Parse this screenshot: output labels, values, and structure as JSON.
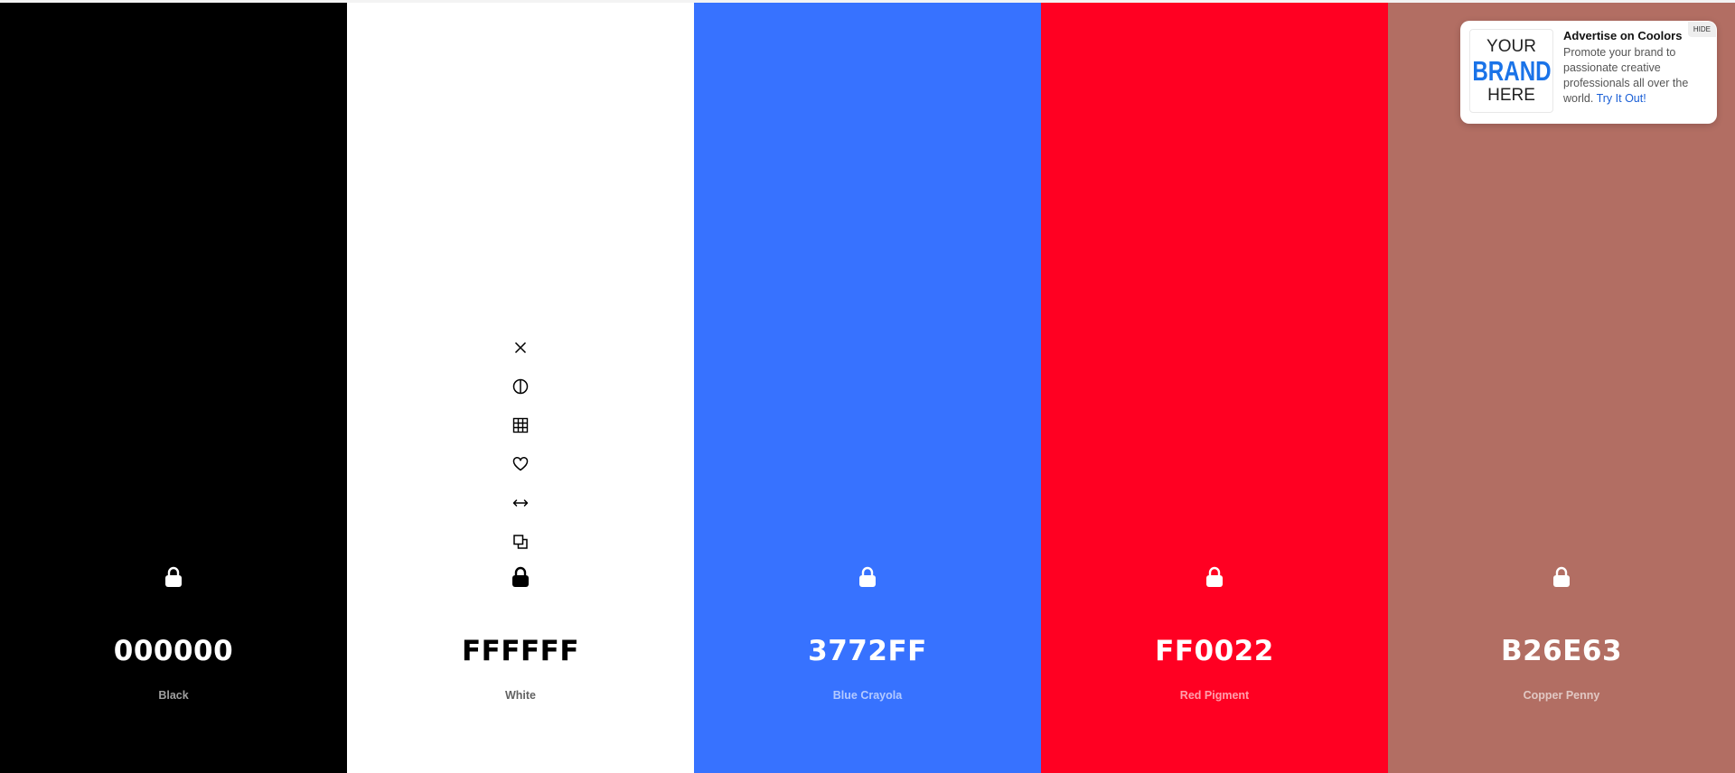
{
  "swatches": [
    {
      "hex": "000000",
      "name": "Black",
      "bg": "#000000",
      "tone": "dark"
    },
    {
      "hex": "FFFFFF",
      "name": "White",
      "bg": "#FFFFFF",
      "tone": "light"
    },
    {
      "hex": "3772FF",
      "name": "Blue Crayola",
      "bg": "#3772FF",
      "tone": "dark"
    },
    {
      "hex": "FF0022",
      "name": "Red Pigment",
      "bg": "#FF0022",
      "tone": "dark"
    },
    {
      "hex": "B26E63",
      "name": "Copper Penny",
      "bg": "#B26E63",
      "tone": "dark"
    }
  ],
  "hovered_swatch_tools": [
    "close-icon",
    "contrast-icon",
    "shades-grid-icon",
    "heart-icon",
    "drag-arrows-icon",
    "copy-icon",
    "lock-icon"
  ],
  "ad": {
    "logo_line1": "YOUR",
    "logo_line2": "BRAND",
    "logo_line3": "HERE",
    "title": "Advertise on Coolors",
    "body": "Promote your brand to passionate creative professionals all over the world.",
    "link": "Try It Out!",
    "hide_label": "HIDE"
  }
}
